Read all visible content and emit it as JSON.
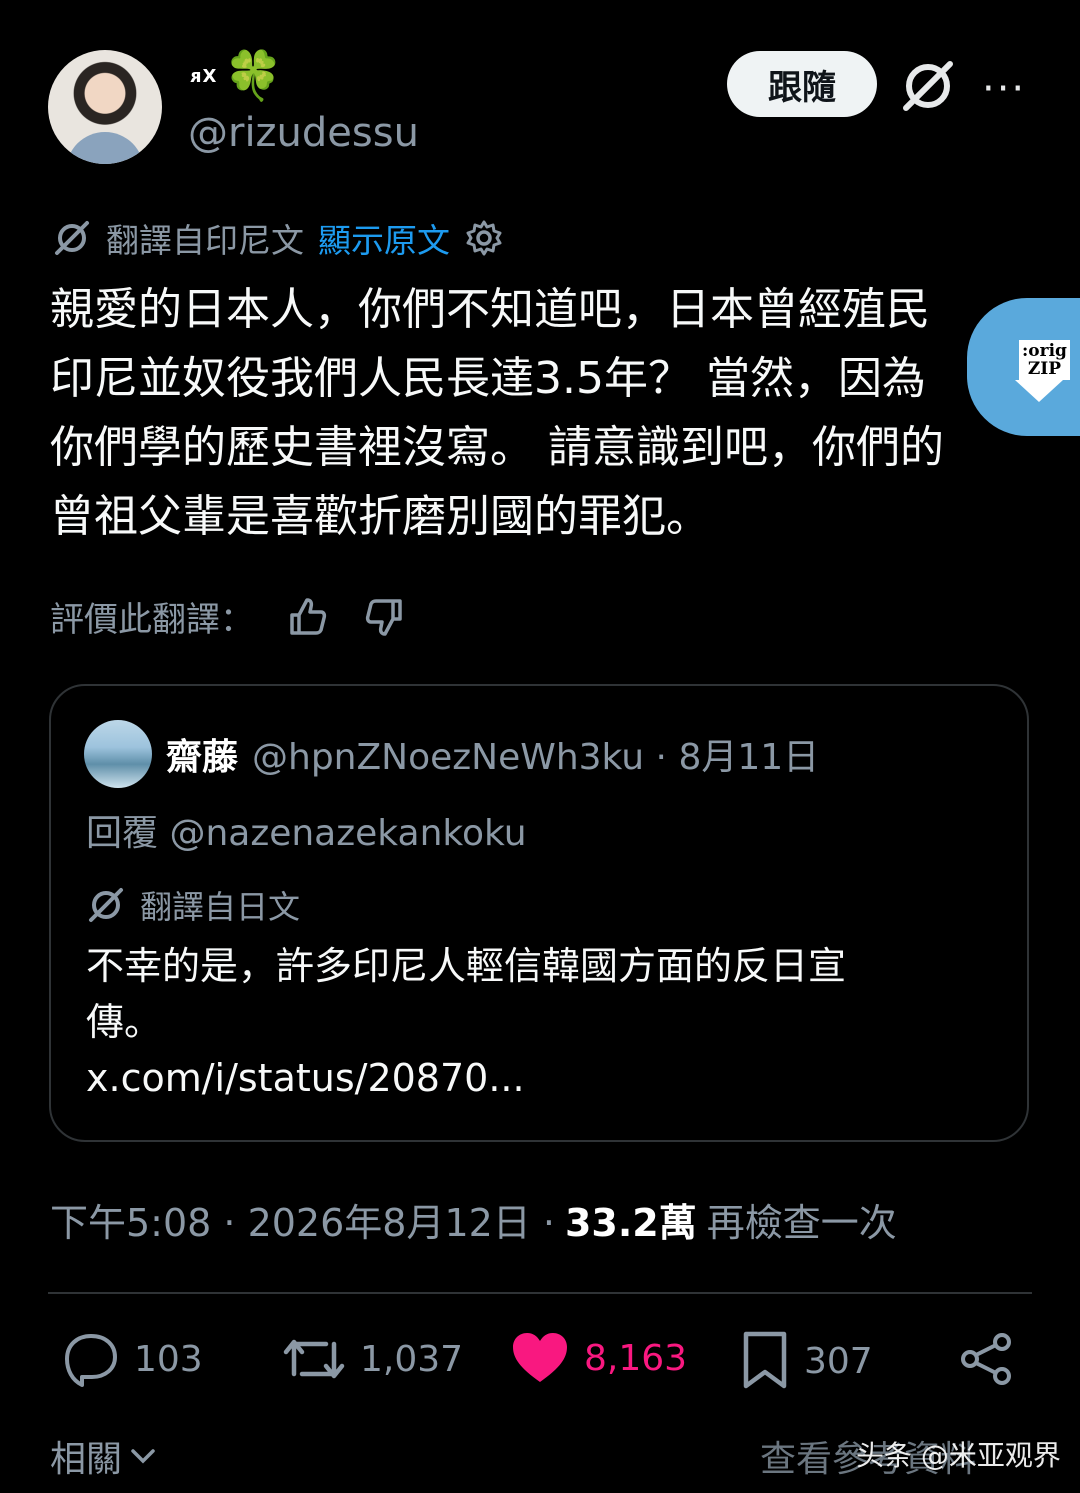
{
  "author": {
    "display_name": "ᴙX",
    "emoji": "🍀",
    "handle": "@rizudessu"
  },
  "header": {
    "follow_label": "跟隨",
    "more_label": "···"
  },
  "translation": {
    "label": "翻譯自印尼文",
    "show_original": "顯示原文"
  },
  "tweet_text": "親愛的日本人，你們不知道吧，日本曾經殖民\n印尼並奴役我們人民長達3.5年？ 當然，因為\n你們學的歷史書裡沒寫。 請意識到吧，你們的\n曾祖父輩是喜歡折磨別國的罪犯。",
  "zip_badge": {
    "line1": ":orig",
    "line2": "ZIP"
  },
  "rate": {
    "label": "評價此翻譯："
  },
  "quote": {
    "name": "齋藤",
    "handle_date": "@hpnZNoezNeWh3ku · 8月11日",
    "reply_to": "回覆 @nazenazekankoku",
    "translated_from": "翻譯自日文",
    "text_line1": "不幸的是，許多印尼人輕信韓國方面的反日宣",
    "text_line2": "傳。",
    "link": "x.com/i/status/20870..."
  },
  "meta": {
    "time_date": "下午5:08 · 2026年8月12日 ·",
    "views": "33.2萬",
    "recheck": "再檢查一次"
  },
  "actions": {
    "replies": "103",
    "retweets": "1,037",
    "likes": "8,163",
    "bookmarks": "307"
  },
  "footer": {
    "related": "相關",
    "see_more": "查看參考資料",
    "watermark": "头条 @米亚观界"
  },
  "colors": {
    "background": "#000000",
    "link": "#1d9bf0",
    "like": "#f91880",
    "muted": "#8b98a5"
  }
}
